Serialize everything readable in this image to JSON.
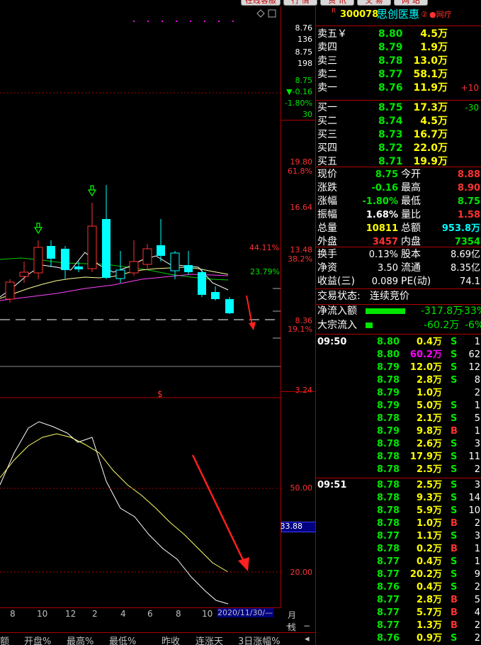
{
  "topmenu": [
    "在线客服",
    "行  情",
    "资  讯",
    "交  易",
    "网  站"
  ],
  "stock": {
    "mark": "R",
    "code": "300078",
    "name": "思创医惠",
    "badge": "②",
    "tag": "●网疗"
  },
  "price_scale": {
    "top": [
      "8.76",
      "136",
      "8.75",
      "198",
      "8.75",
      "▼-0.16",
      "-1.80%",
      "30"
    ],
    "labels": [
      {
        "v": "19.80",
        "c": "red"
      },
      {
        "v": "61.8%",
        "c": "red"
      },
      {
        "v": "16.64",
        "c": "red"
      },
      {
        "v": "13.48",
        "c": "red"
      },
      {
        "v": "38.2%",
        "c": "red"
      },
      {
        "v": "44.11%",
        "c": "red"
      },
      {
        "v": "23.79%",
        "c": "green"
      },
      {
        "v": "8.36",
        "c": "red"
      },
      {
        "v": "19.1%",
        "c": "red"
      },
      {
        "v": "3.24",
        "c": "red"
      }
    ],
    "osc": [
      "50.00",
      "33.88",
      "20.00"
    ]
  },
  "chart_marker": "$",
  "xaxis": [
    "8",
    "10",
    "12",
    "2",
    "4",
    "6",
    "8",
    "10",
    "2020/11/30/—",
    "月线"
  ],
  "zoom": [
    "+",
    "−"
  ],
  "bottom_cols": [
    "额",
    "开盘%",
    "最高%",
    "最低%",
    "昨收",
    "连涨天",
    "3日涨幅%"
  ],
  "orderbook": {
    "sell": [
      {
        "label": "卖五￥",
        "price": "8.80",
        "vol": "4.5万",
        "chg": ""
      },
      {
        "label": "卖四",
        "price": "8.79",
        "vol": "1.9万",
        "chg": ""
      },
      {
        "label": "卖三",
        "price": "8.78",
        "vol": "13.0万",
        "chg": ""
      },
      {
        "label": "卖二",
        "price": "8.77",
        "vol": "58.1万",
        "chg": ""
      },
      {
        "label": "卖一",
        "price": "8.76",
        "vol": "11.9万",
        "chg": "+10"
      }
    ],
    "buy": [
      {
        "label": "买一",
        "price": "8.75",
        "vol": "17.3万",
        "chg": "-30"
      },
      {
        "label": "买二",
        "price": "8.74",
        "vol": "4.5万",
        "chg": ""
      },
      {
        "label": "买三",
        "price": "8.73",
        "vol": "16.7万",
        "chg": ""
      },
      {
        "label": "买四",
        "price": "8.72",
        "vol": "22.0万",
        "chg": ""
      },
      {
        "label": "买五",
        "price": "8.71",
        "vol": "19.9万",
        "chg": ""
      }
    ]
  },
  "quote": [
    {
      "l1": "现价",
      "v1": "8.75",
      "c1": "green",
      "l2": "今开",
      "v2": "8.88",
      "c2": "red"
    },
    {
      "l1": "涨跌",
      "v1": "-0.16",
      "c1": "green",
      "l2": "最高",
      "v2": "8.90",
      "c2": "red"
    },
    {
      "l1": "涨幅",
      "v1": "-1.80%",
      "c1": "green",
      "l2": "最低",
      "v2": "8.75",
      "c2": "green"
    },
    {
      "l1": "振幅",
      "v1": "1.68%",
      "c1": "white",
      "l2": "量比",
      "v2": "1.58",
      "c2": "red"
    },
    {
      "l1": "总量",
      "v1": "10811",
      "c1": "yellow",
      "l2": "总额",
      "v2": "953.8万",
      "c2": "cyan"
    },
    {
      "l1": "外盘",
      "v1": "3457",
      "c1": "red",
      "l2": "内盘",
      "v2": "7354",
      "c2": "green"
    }
  ],
  "fundamentals": [
    {
      "l1": "换手",
      "v1": "0.13%",
      "l2": "股本",
      "v2": "8.69亿"
    },
    {
      "l1": "净资",
      "v1": "3.50",
      "l2": "流通",
      "v2": "8.35亿"
    },
    {
      "l1": "收益(三)",
      "v1": "0.089",
      "l2": "PE(动)",
      "v2": "74.1"
    }
  ],
  "status": {
    "label": "交易状态:",
    "value": "连续竞价"
  },
  "flows": [
    {
      "label": "净流入额",
      "amount": "-317.8万",
      "pct": "-33%"
    },
    {
      "label": "大宗流入",
      "amount": "-60.2万",
      "pct": "-6%"
    }
  ],
  "ticks": [
    {
      "time": "09:50",
      "price": "8.80",
      "vol": "0.4万",
      "vc": "yellow",
      "side": "S",
      "n": "1"
    },
    {
      "time": "",
      "price": "8.80",
      "vol": "60.2万",
      "vc": "magenta",
      "side": "S",
      "n": "62"
    },
    {
      "time": "",
      "price": "8.79",
      "vol": "12.0万",
      "vc": "yellow",
      "side": "S",
      "n": "12"
    },
    {
      "time": "",
      "price": "8.78",
      "vol": "2.8万",
      "vc": "yellow",
      "side": "S",
      "n": "8"
    },
    {
      "time": "",
      "price": "8.79",
      "vol": "1.0万",
      "vc": "yellow",
      "side": "",
      "n": "2"
    },
    {
      "time": "",
      "price": "8.79",
      "vol": "5.0万",
      "vc": "yellow",
      "side": "S",
      "n": "1"
    },
    {
      "time": "",
      "price": "8.78",
      "vol": "2.1万",
      "vc": "yellow",
      "side": "S",
      "n": "5"
    },
    {
      "time": "",
      "price": "8.79",
      "vol": "9.8万",
      "vc": "yellow",
      "side": "B",
      "n": "1"
    },
    {
      "time": "",
      "price": "8.78",
      "vol": "2.6万",
      "vc": "yellow",
      "side": "S",
      "n": "3"
    },
    {
      "time": "",
      "price": "8.78",
      "vol": "17.9万",
      "vc": "yellow",
      "side": "S",
      "n": "11"
    },
    {
      "time": "",
      "price": "8.78",
      "vol": "2.5万",
      "vc": "yellow",
      "side": "S",
      "n": "2"
    },
    {
      "time": "09:51",
      "price": "8.78",
      "vol": "2.5万",
      "vc": "yellow",
      "side": "S",
      "n": "3"
    },
    {
      "time": "",
      "price": "8.78",
      "vol": "9.3万",
      "vc": "yellow",
      "side": "S",
      "n": "14"
    },
    {
      "time": "",
      "price": "8.78",
      "vol": "5.9万",
      "vc": "yellow",
      "side": "S",
      "n": "10"
    },
    {
      "time": "",
      "price": "8.78",
      "vol": "1.0万",
      "vc": "yellow",
      "side": "B",
      "n": "2"
    },
    {
      "time": "",
      "price": "8.77",
      "vol": "1.1万",
      "vc": "yellow",
      "side": "S",
      "n": "3"
    },
    {
      "time": "",
      "price": "8.78",
      "vol": "0.2万",
      "vc": "yellow",
      "side": "B",
      "n": "1"
    },
    {
      "time": "",
      "price": "8.77",
      "vol": "0.4万",
      "vc": "yellow",
      "side": "S",
      "n": "1"
    },
    {
      "time": "",
      "price": "8.77",
      "vol": "20.2万",
      "vc": "yellow",
      "side": "S",
      "n": "9"
    },
    {
      "time": "",
      "price": "8.76",
      "vol": "0.4万",
      "vc": "yellow",
      "side": "S",
      "n": "2"
    },
    {
      "time": "",
      "price": "8.77",
      "vol": "2.8万",
      "vc": "yellow",
      "side": "B",
      "n": "5"
    },
    {
      "time": "",
      "price": "8.77",
      "vol": "5.7万",
      "vc": "yellow",
      "side": "B",
      "n": "4"
    },
    {
      "time": "",
      "price": "8.77",
      "vol": "1.3万",
      "vc": "yellow",
      "side": "B",
      "n": "2"
    },
    {
      "time": "",
      "price": "8.76",
      "vol": "0.9万",
      "vc": "yellow",
      "side": "S",
      "n": "2"
    }
  ]
}
